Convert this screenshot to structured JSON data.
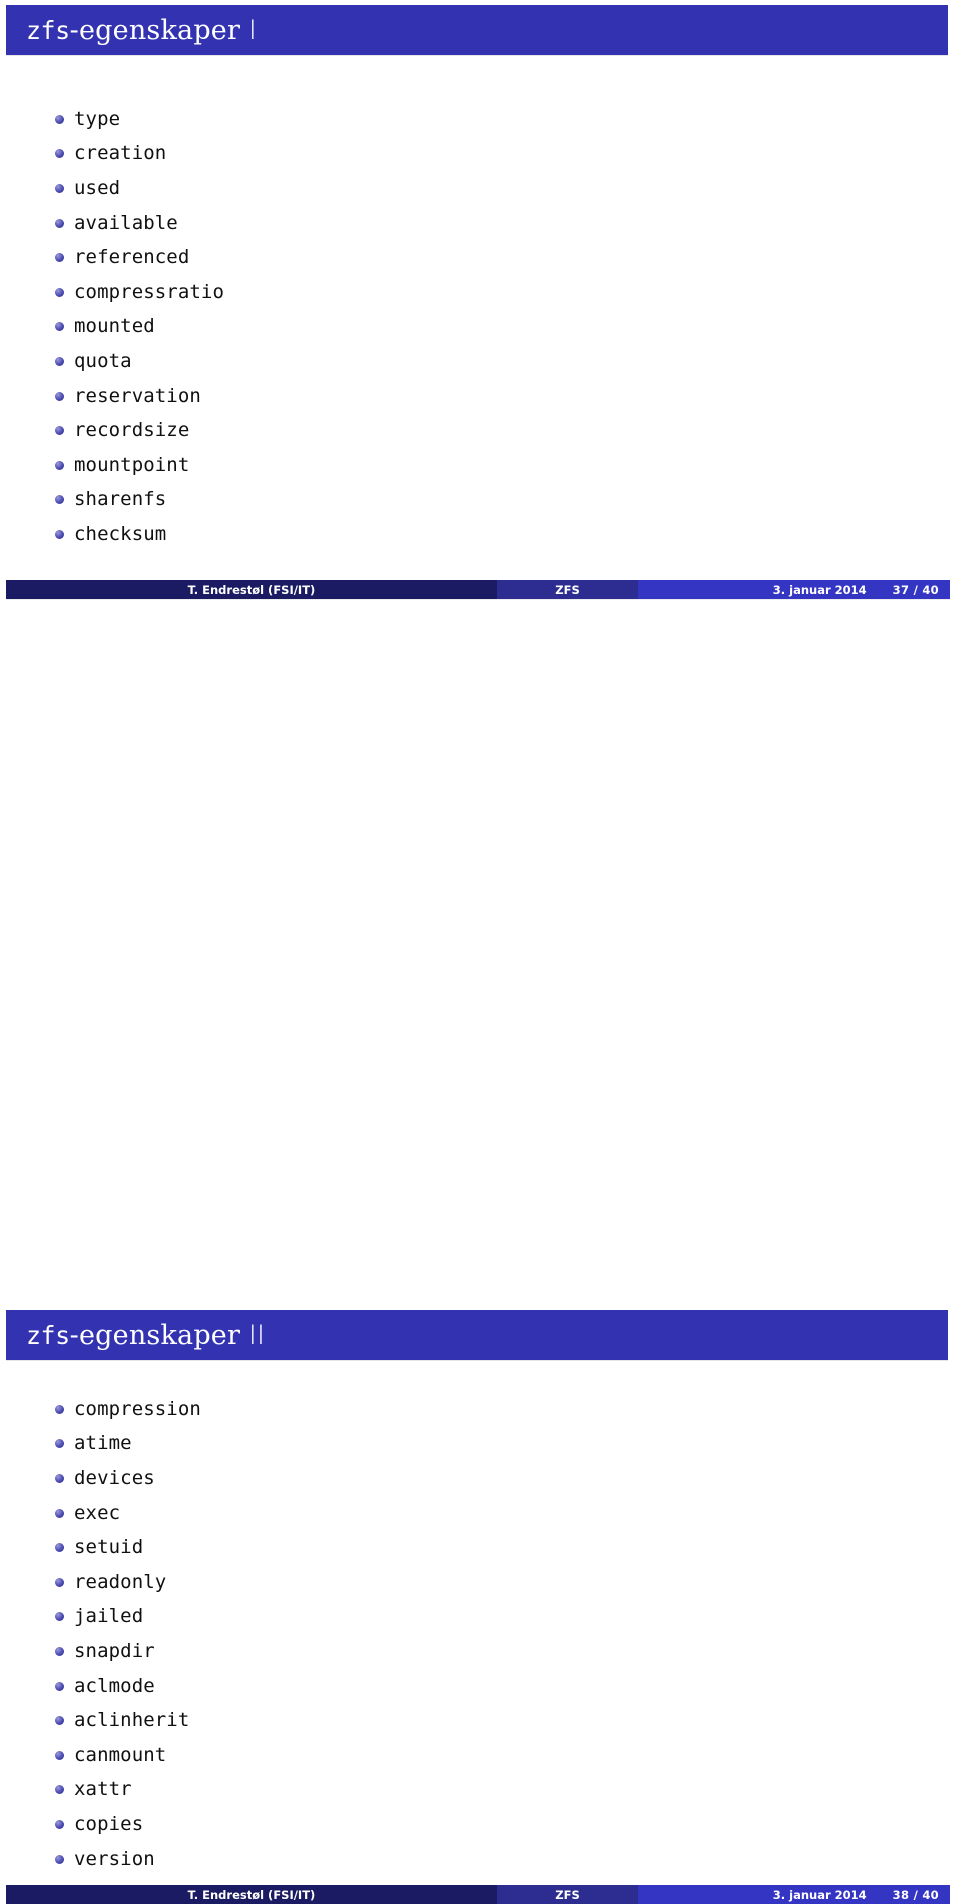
{
  "theme": {
    "title_bar_color": "#3333b2",
    "footer_author_color": "#1b1b63",
    "footer_title_color": "#2d2d91",
    "footer_meta_color": "#3535c4",
    "bullet_color": "#3d3da4",
    "text_color": "#101010"
  },
  "slides": [
    {
      "title_mono": "zfs",
      "title_rest": "-egenskaper ",
      "title_numeral": "I",
      "items": [
        "type",
        "creation",
        "used",
        "available",
        "referenced",
        "compressratio",
        "mounted",
        "quota",
        "reservation",
        "recordsize",
        "mountpoint",
        "sharenfs",
        "checksum"
      ],
      "footer": {
        "author": "T. Endrestøl  (FSI/IT)",
        "title": "ZFS",
        "date": "3. januar 2014",
        "page": "37 / 40"
      }
    },
    {
      "title_mono": "zfs",
      "title_rest": "-egenskaper ",
      "title_numeral": "II",
      "items": [
        "compression",
        "atime",
        "devices",
        "exec",
        "setuid",
        "readonly",
        "jailed",
        "snapdir",
        "aclmode",
        "aclinherit",
        "canmount",
        "xattr",
        "copies",
        "version"
      ],
      "footer": {
        "author": "T. Endrestøl  (FSI/IT)",
        "title": "ZFS",
        "date": "3. januar 2014",
        "page": "38 / 40"
      }
    }
  ]
}
